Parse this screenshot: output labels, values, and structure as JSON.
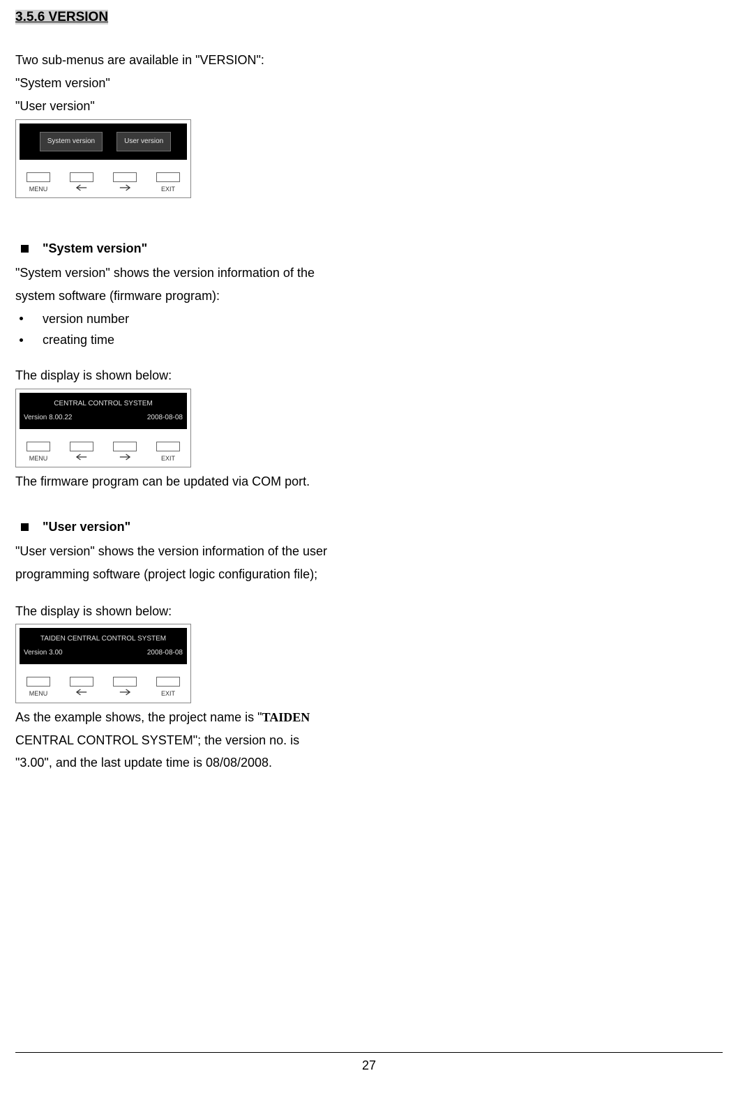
{
  "heading": "3.5.6 VERSION",
  "intro": {
    "line1": "Two sub-menus are available in \"VERSION\":",
    "line2": "\"System version\"",
    "line3": "\"User version\""
  },
  "lcd_tabs": {
    "tab1": "System version",
    "tab2": "User version"
  },
  "lcd_buttons": {
    "menu": "MENU",
    "exit": "EXIT"
  },
  "system_version": {
    "title": "\"System version\"",
    "desc1": "\"System version\" shows the version information of the",
    "desc2": "system software (firmware program):",
    "bullet1": "version number",
    "bullet2": "creating time",
    "display_label": "The display is shown below:",
    "screen_title": "CENTRAL CONTROL SYSTEM",
    "screen_version": "Version 8.00.22",
    "screen_date": "2008-08-08",
    "after": "The firmware program can be updated via COM port."
  },
  "user_version": {
    "title": "\"User version\"",
    "desc1": "\"User version\" shows the version information of the user",
    "desc2": "programming software (project logic configuration file);",
    "display_label": "The display is shown below:",
    "screen_title": "TAIDEN CENTRAL CONTROL SYSTEM",
    "screen_version": "Version 3.00",
    "screen_date": "2008-08-08",
    "after1a": "As the example shows, the project name is \"",
    "after1b": "TAIDEN",
    "after2": "CENTRAL CONTROL SYSTEM\"; the version no. is",
    "after3": "\"3.00\", and the last update time is 08/08/2008."
  },
  "page_number": "27"
}
